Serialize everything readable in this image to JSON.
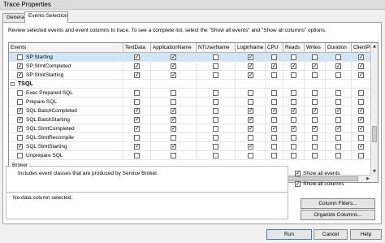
{
  "window": {
    "title": "Trace Properties"
  },
  "tabs": [
    {
      "label": "General",
      "active": false
    },
    {
      "label": "Events Selection",
      "active": true
    }
  ],
  "description": "Review selected events and event columns to trace. To see a complete list, select the \"Show all events\" and \"Show all columns\" options.",
  "grid": {
    "columns": [
      "Events",
      "TextData",
      "ApplicationName",
      "NTUserName",
      "LoginName",
      "CPU",
      "Reads",
      "Writes",
      "Duration",
      "ClientProc"
    ],
    "rows": [
      {
        "name": "SP:Starting",
        "kind": "event",
        "selected": true,
        "event_checked": false,
        "checks": [
          true,
          true,
          false,
          true,
          false,
          false,
          false,
          false,
          true
        ]
      },
      {
        "name": "SP:StmtCompleted",
        "kind": "event",
        "selected": false,
        "event_checked": true,
        "checks": [
          true,
          true,
          false,
          true,
          true,
          true,
          true,
          true,
          true
        ]
      },
      {
        "name": "SP:StmtStarting",
        "kind": "event",
        "selected": false,
        "event_checked": true,
        "checks": [
          true,
          true,
          false,
          true,
          false,
          false,
          false,
          false,
          true
        ]
      },
      {
        "name": "TSQL",
        "kind": "category",
        "selected": false,
        "event_checked": false,
        "checks": []
      },
      {
        "name": "Exec Prepared SQL",
        "kind": "event",
        "selected": false,
        "event_checked": false,
        "checks": [
          false,
          false,
          false,
          false,
          false,
          false,
          false,
          false,
          false
        ]
      },
      {
        "name": "Prepare SQL",
        "kind": "event",
        "selected": false,
        "event_checked": false,
        "checks": [
          false,
          false,
          false,
          false,
          false,
          false,
          false,
          false,
          false
        ]
      },
      {
        "name": "SQL:BatchCompleted",
        "kind": "event",
        "selected": false,
        "event_checked": true,
        "checks": [
          true,
          true,
          false,
          true,
          true,
          true,
          true,
          true,
          true
        ]
      },
      {
        "name": "SQL:BatchStarting",
        "kind": "event",
        "selected": false,
        "event_checked": true,
        "checks": [
          true,
          true,
          false,
          true,
          false,
          false,
          false,
          false,
          true
        ]
      },
      {
        "name": "SQL:StmtCompleted",
        "kind": "event",
        "selected": false,
        "event_checked": true,
        "checks": [
          true,
          true,
          false,
          true,
          true,
          true,
          true,
          true,
          true
        ]
      },
      {
        "name": "SQL:StmtRecompile",
        "kind": "event",
        "selected": false,
        "event_checked": false,
        "checks": [
          false,
          false,
          false,
          false,
          false,
          false,
          false,
          false,
          false
        ]
      },
      {
        "name": "SQL:StmtStarting",
        "kind": "event",
        "selected": false,
        "event_checked": true,
        "checks": [
          true,
          true,
          false,
          true,
          false,
          false,
          false,
          false,
          true
        ]
      },
      {
        "name": "Unprepare SQL",
        "kind": "event",
        "selected": false,
        "event_checked": false,
        "checks": [
          false,
          false,
          false,
          false,
          false,
          false,
          false,
          false,
          false
        ]
      }
    ]
  },
  "broker_box": {
    "title": "Broker",
    "text": "Includes event classes that are produced by Service Broker."
  },
  "column_box": {
    "text": "No data column selected."
  },
  "options": {
    "show_all_events": {
      "label": "Show all events",
      "checked": true
    },
    "show_all_columns": {
      "label": "Show all columns",
      "checked": true
    }
  },
  "buttons": {
    "column_filters": "Column Filters...",
    "organize_columns": "Organize Columns...",
    "run": "Run",
    "cancel": "Cancel",
    "help": "Help"
  },
  "colors": {
    "selection": "#cfe6f7",
    "dialog_bg": "#f0f0f0"
  }
}
